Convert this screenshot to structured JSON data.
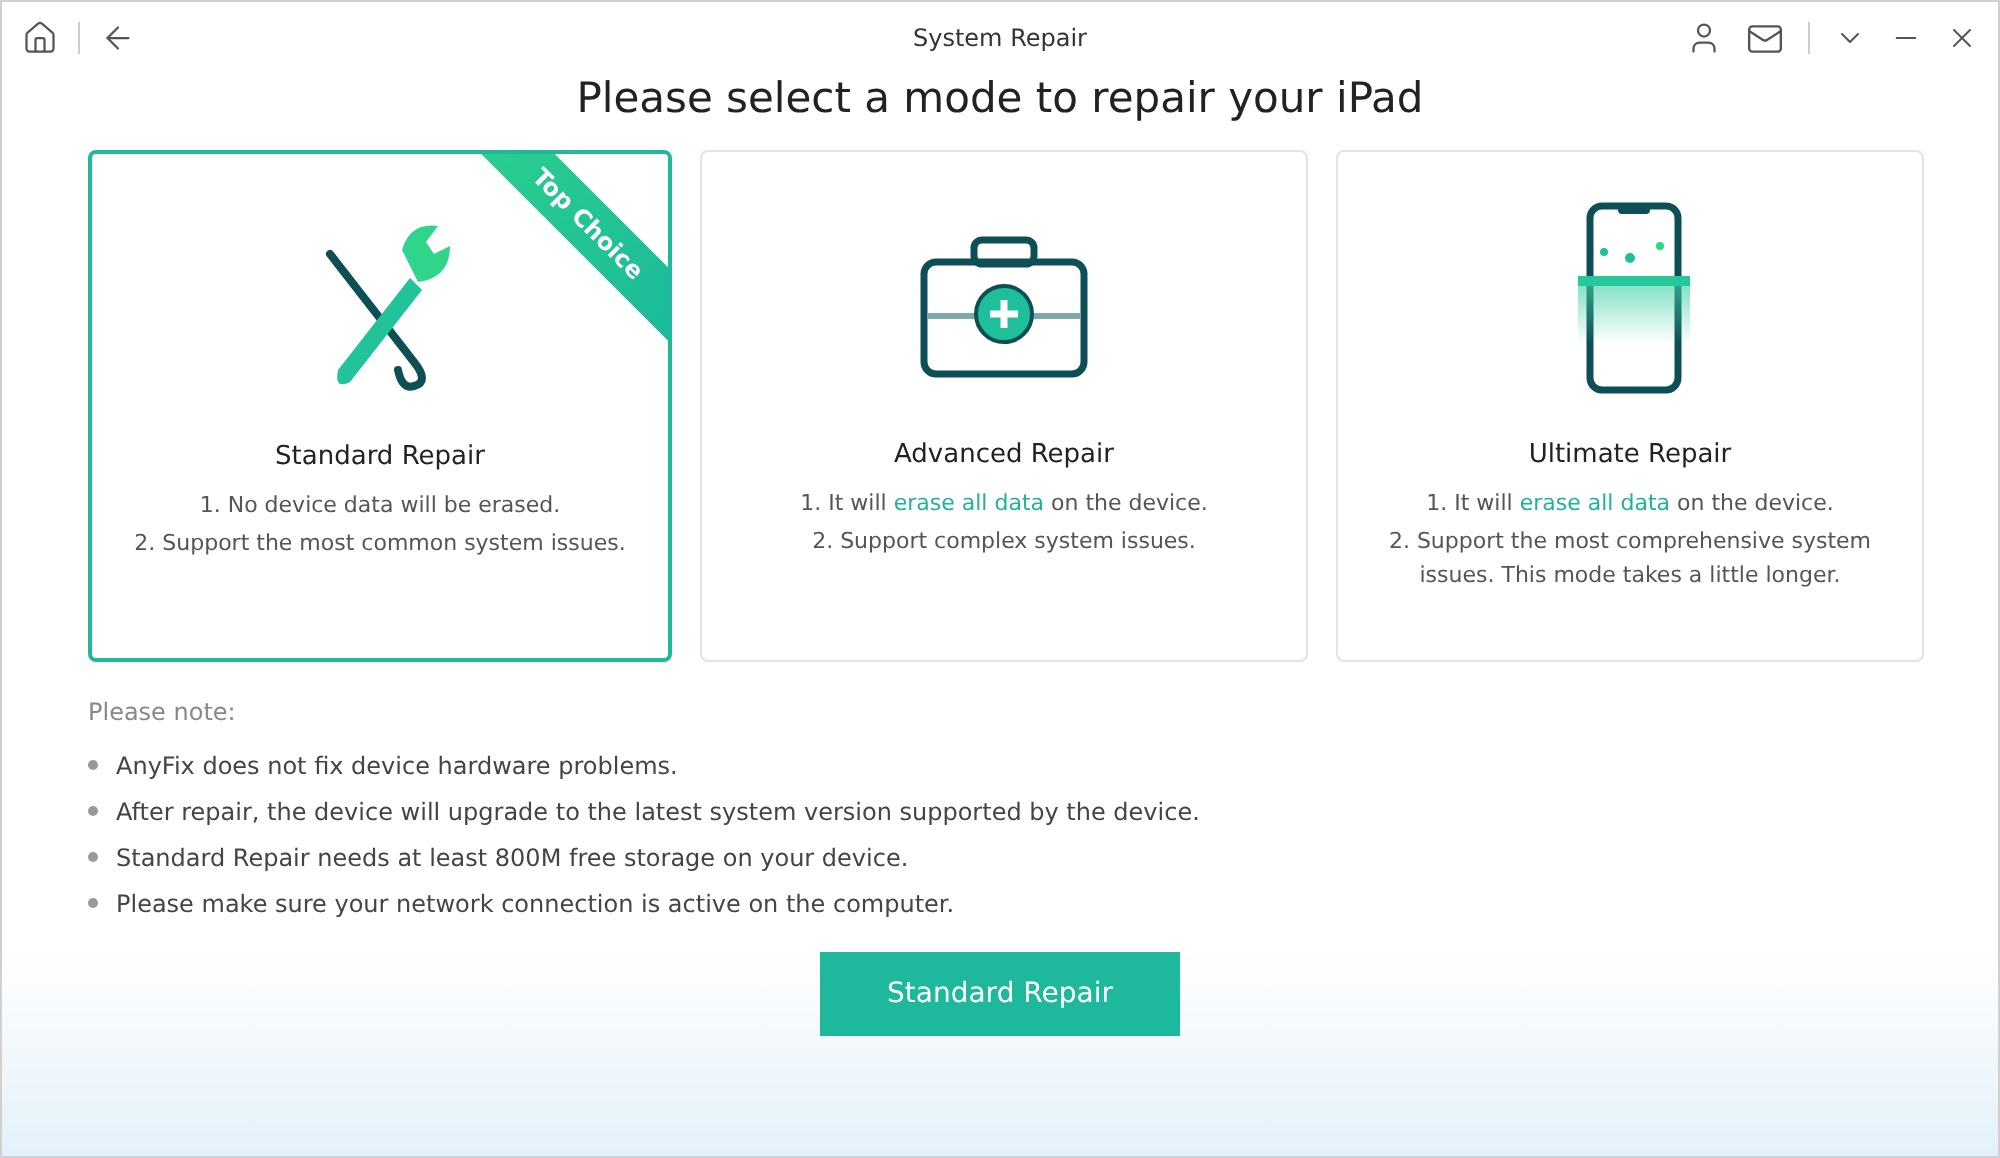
{
  "window": {
    "title": "System Repair"
  },
  "heading": "Please select a mode to repair your iPad",
  "modes": [
    {
      "kind": "wrench",
      "title": "Standard Repair",
      "selected": true,
      "badge": "Top Choice",
      "lines": [
        [
          {
            "text": "1. No device data will be erased.",
            "highlight": false
          }
        ],
        [
          {
            "text": "2. Support the most common system issues.",
            "highlight": false
          }
        ]
      ]
    },
    {
      "kind": "kit",
      "title": "Advanced Repair",
      "selected": false,
      "lines": [
        [
          {
            "text": "1. It will ",
            "highlight": false
          },
          {
            "text": "erase all data",
            "highlight": true
          },
          {
            "text": " on the device.",
            "highlight": false
          }
        ],
        [
          {
            "text": "2. Support complex system issues.",
            "highlight": false
          }
        ]
      ]
    },
    {
      "kind": "phone",
      "title": "Ultimate Repair",
      "selected": false,
      "lines": [
        [
          {
            "text": "1. It will ",
            "highlight": false
          },
          {
            "text": "erase all data",
            "highlight": true
          },
          {
            "text": " on the device.",
            "highlight": false
          }
        ],
        [
          {
            "text": "2. Support the most comprehensive system issues. This mode takes a little longer.",
            "highlight": false
          }
        ]
      ]
    }
  ],
  "note": {
    "title": "Please note:",
    "items": [
      "AnyFix does not fix device hardware problems.",
      "After repair, the device will upgrade to the latest system version supported by the device.",
      "Standard Repair needs at least 800M free storage on your device.",
      "Please make sure your network connection is active on the computer."
    ]
  },
  "action_button": "Standard Repair"
}
